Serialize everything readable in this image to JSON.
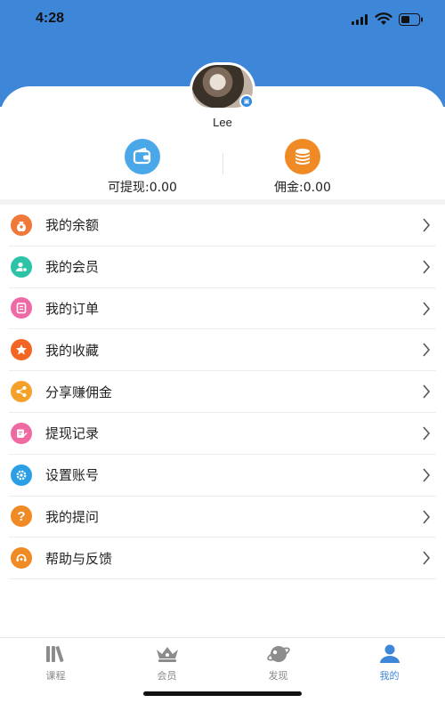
{
  "status_bar": {
    "time": "4:28"
  },
  "profile": {
    "username": "Lee",
    "avatar_badge_icon": "edit-badge-icon"
  },
  "stats": {
    "withdrawable": {
      "label": "可提现:0.00",
      "icon": "wallet-icon",
      "color": "#4aa8e8"
    },
    "commission": {
      "label": "佣金:0.00",
      "icon": "coins-icon",
      "color": "#f08a24"
    }
  },
  "menu": {
    "items": [
      {
        "label": "我的余额",
        "icon": "money-bag-icon",
        "color": "#f0793a"
      },
      {
        "label": "我的会员",
        "icon": "member-icon",
        "color": "#2cc3a6"
      },
      {
        "label": "我的订单",
        "icon": "order-icon",
        "color": "#ee6aa7"
      },
      {
        "label": "我的收藏",
        "icon": "star-icon",
        "color": "#f26522"
      },
      {
        "label": "分享赚佣金",
        "icon": "share-icon",
        "color": "#f4a12a"
      },
      {
        "label": "提现记录",
        "icon": "withdraw-record-icon",
        "color": "#ee6aa0"
      },
      {
        "label": "设置账号",
        "icon": "settings-icon",
        "color": "#2b9fe6"
      },
      {
        "label": "我的提问",
        "icon": "question-icon",
        "color": "#f08a24"
      },
      {
        "label": "帮助与反馈",
        "icon": "feedback-icon",
        "color": "#f08a24"
      }
    ]
  },
  "tabbar": {
    "tabs": [
      {
        "label": "课程",
        "icon": "books-icon"
      },
      {
        "label": "会员",
        "icon": "crown-icon"
      },
      {
        "label": "发现",
        "icon": "discover-icon"
      },
      {
        "label": "我的",
        "icon": "person-icon",
        "active": true
      }
    ]
  },
  "colors": {
    "header": "#3e86d8",
    "active_tab": "#3e86d8"
  }
}
